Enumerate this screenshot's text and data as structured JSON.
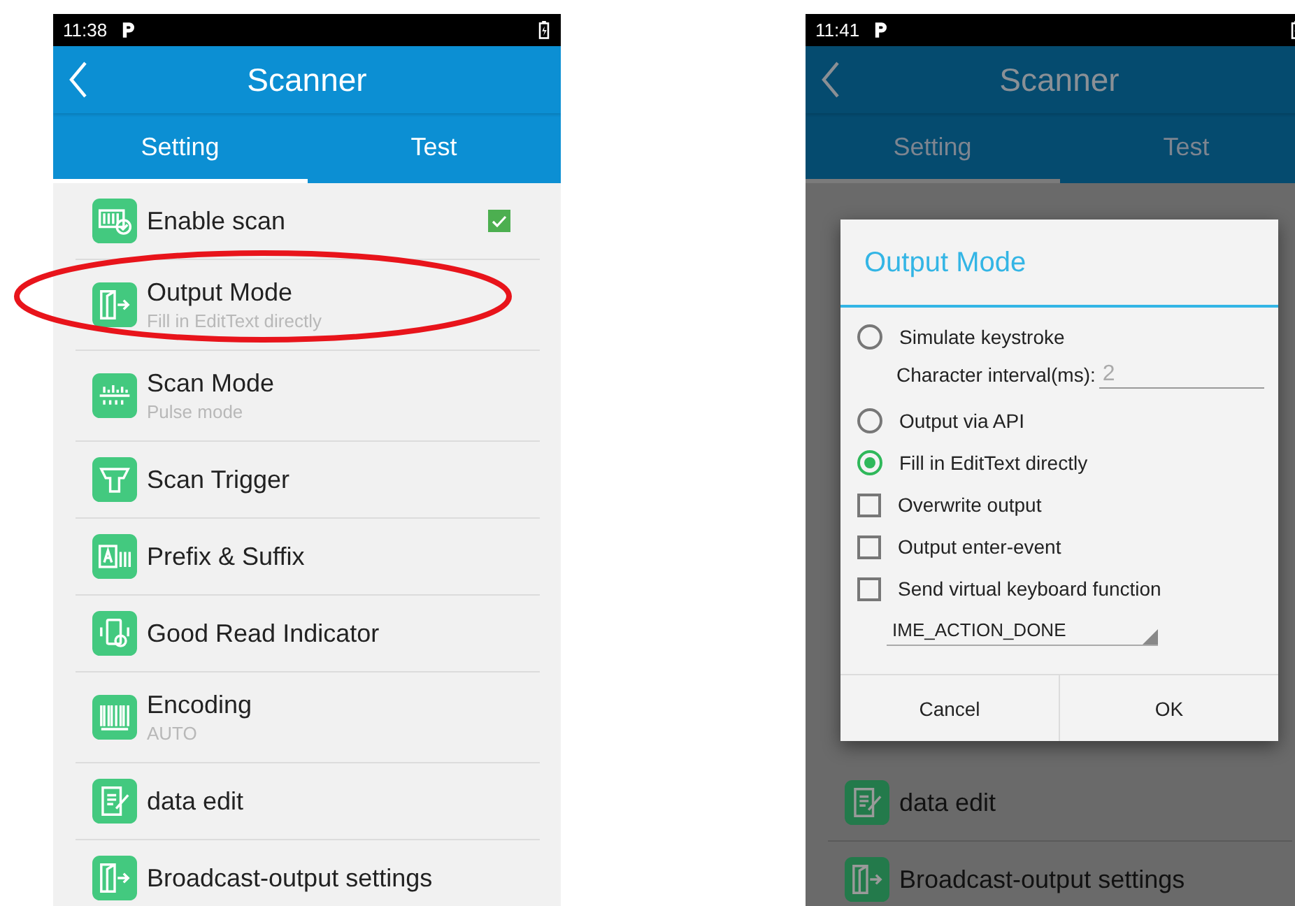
{
  "screens": [
    {
      "status_bar": {
        "time": "11:38"
      },
      "header": {
        "title": "Scanner"
      },
      "tabs": [
        {
          "label": "Setting",
          "selected": true
        },
        {
          "label": "Test",
          "selected": false
        }
      ],
      "settings": [
        {
          "kind": "enable",
          "title": "Enable scan",
          "checked": true
        },
        {
          "kind": "output",
          "title": "Output Mode",
          "subtitle": "Fill in EditText directly"
        },
        {
          "kind": "mode",
          "title": "Scan Mode",
          "subtitle": "Pulse mode"
        },
        {
          "kind": "trigger",
          "title": "Scan Trigger"
        },
        {
          "kind": "affix",
          "title": "Prefix & Suffix"
        },
        {
          "kind": "indicator",
          "title": "Good Read Indicator"
        },
        {
          "kind": "encoding",
          "title": "Encoding",
          "subtitle": "AUTO"
        },
        {
          "kind": "edit",
          "title": "data edit"
        },
        {
          "kind": "broadcast",
          "title": "Broadcast-output settings"
        }
      ]
    },
    {
      "status_bar": {
        "time": "11:41"
      },
      "header": {
        "title": "Scanner"
      },
      "tabs": [
        {
          "label": "Setting",
          "selected": true
        },
        {
          "label": "Test",
          "selected": false
        }
      ],
      "settings": [
        {
          "kind": "edit",
          "title": "data edit"
        },
        {
          "kind": "broadcast",
          "title": "Broadcast-output settings"
        }
      ],
      "dialog": {
        "title": "Output Mode",
        "options": [
          {
            "kind": "radio",
            "label": "Simulate keystroke",
            "selected": false,
            "field": {
              "label": "Character interval(ms):",
              "value": "2"
            }
          },
          {
            "kind": "radio",
            "label": "Output via API",
            "selected": false
          },
          {
            "kind": "radio",
            "label": "Fill in EditText directly",
            "selected": true
          },
          {
            "kind": "checkbox",
            "label": "Overwrite output",
            "checked": false
          },
          {
            "kind": "checkbox",
            "label": "Output enter-event",
            "checked": false
          },
          {
            "kind": "checkbox",
            "label": "Send virtual keyboard function",
            "checked": false
          }
        ],
        "spinner": {
          "value": "IME_ACTION_DONE"
        },
        "buttons": [
          "Cancel",
          "OK"
        ]
      }
    }
  ]
}
